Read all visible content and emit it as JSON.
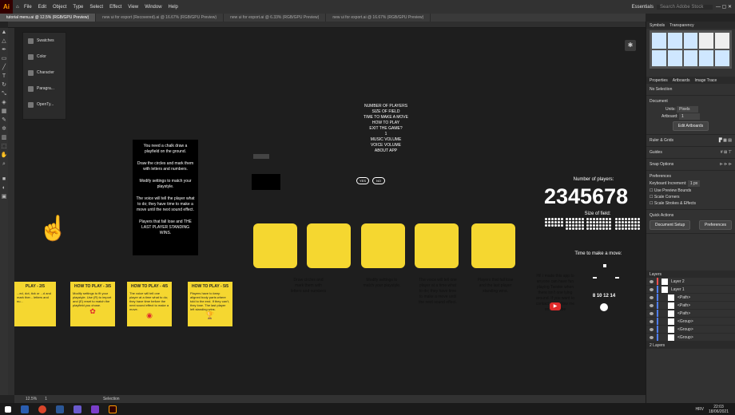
{
  "app": {
    "logo": "Ai"
  },
  "menu": [
    "File",
    "Edit",
    "Object",
    "Type",
    "Select",
    "Effect",
    "View",
    "Window",
    "Help"
  ],
  "workspace": "Essentials",
  "search_placeholder": "Search Adobe Stock",
  "tabs": [
    "tutorial menu.ai @ 12.5% (RGB/GPU Preview)",
    "new ui for export (Recovered).ai @ 16.67% (RGB/GPU Preview)",
    "new ui for export.ai @ 6.33% (RGB/GPU Preview)",
    "new ui for export.ai @ 16.67% (RGB/GPU Preview)"
  ],
  "left_panel": [
    "Swatches",
    "Color",
    "Character",
    "Paragra...",
    "OpenTy..."
  ],
  "canvas": {
    "menu_lines": [
      "NUMBER OF PLAYERS",
      "SIZE OF FIELD",
      "TIME TO MAKE A MOVE",
      "HOW TO PLAY",
      "EXIT THE GAME?",
      "1",
      "MUSIC VOLUME",
      "VOICE VOLUME",
      "ABOUT APP"
    ],
    "yes": "YES",
    "no": "NO",
    "rules_card": [
      "You need a chalk draw a playfield on the ground.",
      "Draw the circles and mark them with letters and numbers.",
      "Modify settings to match your playstyle.",
      "The voice will tell the player what to do; they have time to make a move until the next sound effect.",
      "Players that fall lose and THE LAST PLAYER STANDING WINS."
    ],
    "players_label": "Number of players:",
    "players_numbers": "2345678",
    "field_label": "Size of field:",
    "time_label": "Time to make a move:",
    "time_values": "8 10 12 14",
    "captions": [
      "Draw circles and mark them with letters and numbers",
      "Modify settings to match your playstyle.",
      "The voice will tell one player at a time what to do; they have time to make a move until the next sound effect.",
      "Players that fall lose and the last player standing wins.",
      "Hi! I made this app to anyone can have fun playing Twister when there isn't one lying around. If you want to contact me, follow me on YouTube"
    ],
    "howto": [
      {
        "title": "PLAY - 2/5",
        "text": "...ed, dot, tick or ...d and mark ther... letters and nu..."
      },
      {
        "title": "HOW TO PLAY - 3/5",
        "text": "Modify settings to fit your playstyle. Use (R) to import and (E) reset to match the playfield you chose."
      },
      {
        "title": "HOW TO PLAY - 4/5",
        "text": "The voice will tell one player at a time what to do; they have time before the next sound effect to make a move."
      },
      {
        "title": "HOW TO PLAY - 5/5",
        "text": "Players have to keep aligned body parts where told to the end. If they can't, they lose. The last player left standing wins."
      }
    ]
  },
  "right_panel": {
    "tabs": [
      "Symbols",
      "Transparency"
    ],
    "props_tabs": [
      "Properties",
      "Artboards",
      "Image Trace"
    ],
    "no_selection": "No Selection",
    "document": "Document",
    "units_label": "Units:",
    "units": "Pixels",
    "artboard_label": "Artboard:",
    "artboard": "1",
    "edit_artboards": "Edit Artboards",
    "rulers": "Ruler & Grids",
    "guides": "Guides",
    "snap": "Snap Options",
    "preferences": "Preferences",
    "kb_label": "Keyboard Increment:",
    "kb": "1 px",
    "checks": [
      "Use Preview Bounds",
      "Scale Corners",
      "Scale Strokes & Effects"
    ],
    "quick": "Quick Actions",
    "doc_setup": "Document Setup",
    "prefs_btn": "Preferences",
    "layers_tab": "Layers",
    "layers": [
      {
        "name": "Layer 2",
        "color": "#ff4f4f"
      },
      {
        "name": "Layer 1",
        "color": "#4f7fff"
      },
      {
        "name": "<Path>",
        "color": "#4f7fff"
      },
      {
        "name": "<Path>",
        "color": "#4f7fff"
      },
      {
        "name": "<Path>",
        "color": "#4f7fff"
      },
      {
        "name": "<Group>",
        "color": "#4f7fff"
      },
      {
        "name": "<Group>",
        "color": "#4f7fff"
      },
      {
        "name": "<Group>",
        "color": "#4f7fff"
      }
    ],
    "layers_count": "2 Layers"
  },
  "status": {
    "zoom": "12.5%",
    "artboard": "1",
    "tool": "Selection"
  },
  "taskbar": {
    "time": "22:03",
    "date": "18/06/2021",
    "lang": "HRV"
  }
}
